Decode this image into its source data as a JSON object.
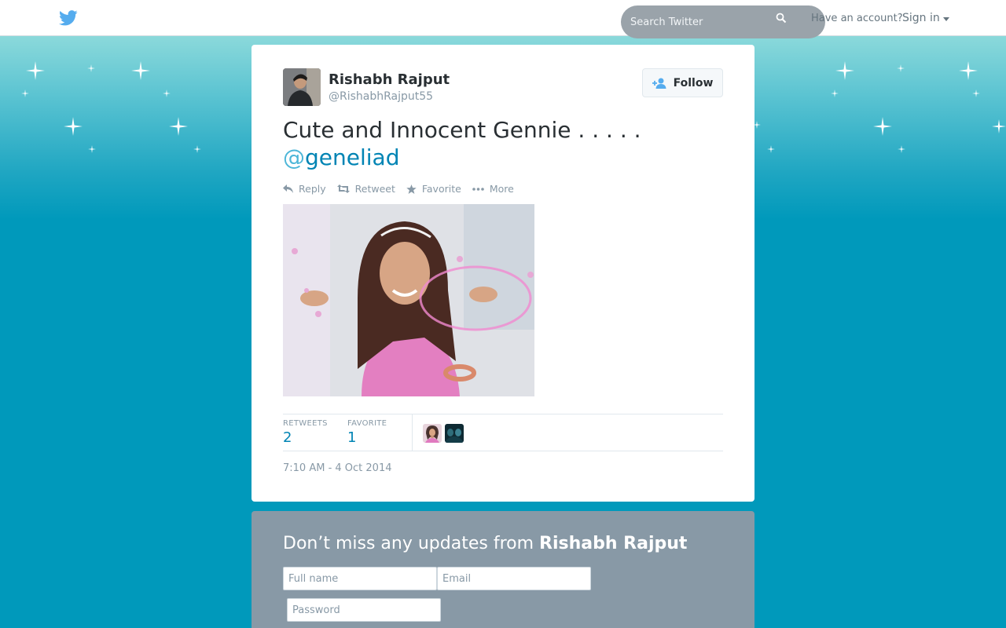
{
  "topbar": {
    "search_placeholder": "Search Twitter",
    "have_account": "Have an account?",
    "sign_in": "Sign in"
  },
  "tweet": {
    "fullname": "Rishabh Rajput",
    "username": "@RishabhRajput55",
    "follow_label": "Follow",
    "text_line1": "Cute and Innocent Gennie . . . . .",
    "mention_at": "@",
    "mention_name": "geneliad",
    "actions": {
      "reply": "Reply",
      "retweet": "Retweet",
      "favorite": "Favorite",
      "more": "More"
    },
    "stats": {
      "retweets_label": "RETWEETS",
      "retweets_value": "2",
      "favorite_label": "FAVORITE",
      "favorite_value": "1"
    },
    "timestamp": "7:10 AM - 4 Oct 2014"
  },
  "signup": {
    "title_prefix": "Don’t miss any updates from",
    "title_name": "Rishabh Rajput",
    "fullname_placeholder": "Full name",
    "email_placeholder": "Email",
    "password_placeholder": "Password"
  },
  "colors": {
    "link": "#0084b4",
    "muted": "#8899a6",
    "twitter_blue": "#55acee",
    "background": "#0099bb"
  }
}
